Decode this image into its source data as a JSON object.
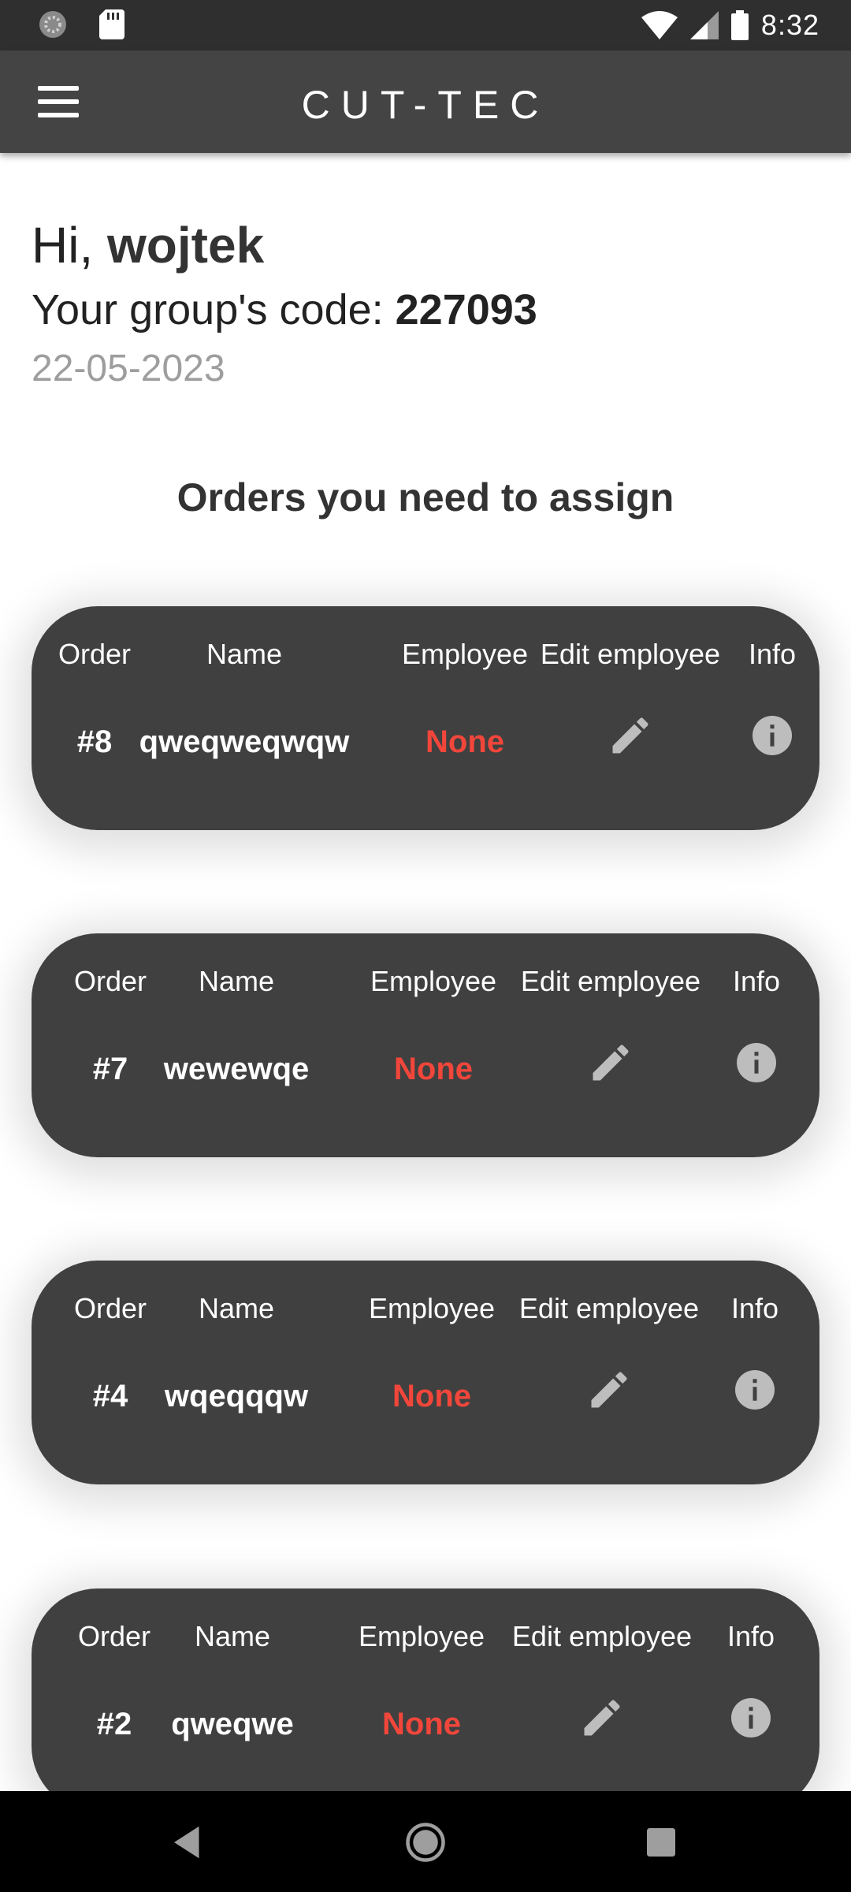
{
  "status_bar": {
    "time": "8:32",
    "icons": [
      "activity-indicator-icon",
      "sd-card-icon",
      "wifi-icon",
      "cellular-signal-icon",
      "battery-icon"
    ]
  },
  "app_bar": {
    "title": "CUT-TEC",
    "menu_icon": "hamburger-menu-icon",
    "background": "#444444"
  },
  "greeting": {
    "prefix": "Hi, ",
    "username": "wojtek"
  },
  "group": {
    "label": "Your group's code: ",
    "code": "227093"
  },
  "date": "22-05-2023",
  "section_title": "Orders you need to assign",
  "columns": {
    "order": "Order",
    "name": "Name",
    "employee": "Employee",
    "edit_employee": "Edit employee",
    "info": "Info"
  },
  "orders": [
    {
      "number": "#8",
      "name": "qweqweqwqw",
      "employee": "None"
    },
    {
      "number": "#7",
      "name": "wewewqe",
      "employee": "None"
    },
    {
      "number": "#4",
      "name": "wqeqqqw",
      "employee": "None"
    },
    {
      "number": "#2",
      "name": "qweqwe",
      "employee": "None"
    }
  ],
  "colors": {
    "card": "#404040",
    "employee_none": "#f2463b",
    "icon": "#bdbdbd"
  },
  "nav_bar": {
    "icons": [
      "back-icon",
      "home-icon",
      "recents-icon"
    ]
  }
}
